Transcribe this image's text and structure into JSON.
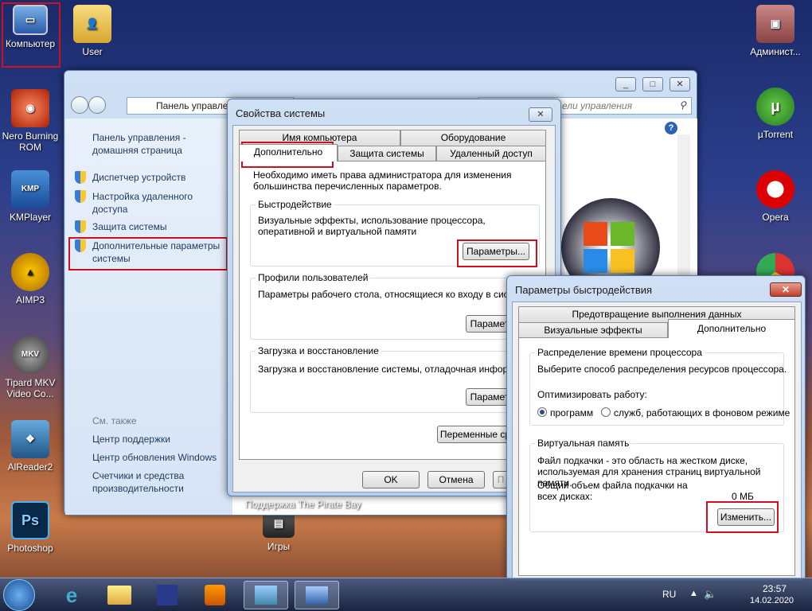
{
  "desktop": {
    "icons_left": [
      {
        "label": "Компьютер"
      },
      {
        "label": "Nero Burning ROM"
      },
      {
        "label": "KMPlayer"
      },
      {
        "label": "AIMP3"
      },
      {
        "label": "Tipard MKV Video Co..."
      },
      {
        "label": "AlReader2"
      },
      {
        "label": "Photoshop"
      }
    ],
    "user_icon": "User",
    "right_icons": [
      {
        "label": "Админист..."
      },
      {
        "label": "µTorrent"
      },
      {
        "label": "Opera"
      }
    ],
    "games_icon": "Игры",
    "pirate_bay_label": "Поддержка The Pirate Bay"
  },
  "control_panel": {
    "address": "Панель управле",
    "search_placeholder": "ели управления",
    "home_link": "Панель управления - домашняя страница",
    "links": [
      {
        "label": "Диспетчер устройств"
      },
      {
        "label": "Настройка удаленного доступа"
      },
      {
        "label": "Защита системы"
      },
      {
        "label": "Дополнительные параметры системы"
      }
    ],
    "see_also": "См. также",
    "see_also_links": [
      {
        "label": "Центр поддержки"
      },
      {
        "label": "Центр обновления Windows"
      },
      {
        "label": "Счетчики и средства производительности"
      }
    ]
  },
  "sys_props": {
    "title": "Свойства системы",
    "tabs_row1": [
      "Имя компьютера",
      "Оборудование"
    ],
    "tabs_row2": [
      "Дополнительно",
      "Защита системы",
      "Удаленный доступ"
    ],
    "admin_note": "Необходимо иметь права администратора для изменения большинства перечисленных параметров.",
    "performance": {
      "title": "Быстродействие",
      "desc": "Визуальные эффекты, использование процессора, оперативной и виртуальной памяти",
      "button": "Параметры..."
    },
    "profiles": {
      "title": "Профили пользователей",
      "desc": "Параметры рабочего стола, относящиеся ко входу в систему",
      "button": "Парамет"
    },
    "startup": {
      "title": "Загрузка и восстановление",
      "desc": "Загрузка и восстановление системы, отладочная информаци",
      "button": "Парамет"
    },
    "env_button": "Переменные ср",
    "ok": "OK",
    "cancel": "Отмена",
    "apply": "П"
  },
  "perf_options": {
    "title": "Параметры быстродействия",
    "tab_dep": "Предотвращение выполнения данных",
    "tab_visual": "Визуальные эффекты",
    "tab_advanced": "Дополнительно",
    "cpu": {
      "title": "Распределение времени процессора",
      "desc": "Выберите способ распределения ресурсов процессора.",
      "optimize_label": "Оптимизировать работу:",
      "opt_programs": "программ",
      "opt_services": "служб, работающих в фоновом режиме"
    },
    "vm": {
      "title": "Виртуальная память",
      "desc": "Файл подкачки - это область на жестком диске, используемая для хранения страниц виртуальной памяти.",
      "total_label": "Общий объем файла подкачки на всех дисках:",
      "total_value": "0 МБ",
      "change_button": "Изменить..."
    }
  },
  "taskbar": {
    "lang": "RU",
    "time": "23:57",
    "date": "14.02.2020"
  }
}
